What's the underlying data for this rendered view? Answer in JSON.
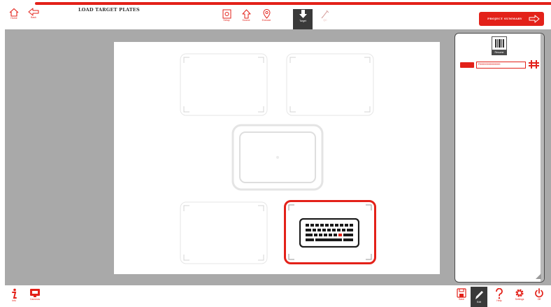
{
  "header": {
    "home_label": "Home",
    "back_label": "Back",
    "title": "LOAD TARGET PLATES",
    "steps": [
      {
        "label": "Setup",
        "icon": "setup-icon",
        "state": "normal"
      },
      {
        "label": "Source",
        "icon": "upload-arrow-icon",
        "state": "normal"
      },
      {
        "label": "Execute",
        "icon": "location-pin-icon",
        "state": "normal"
      },
      {
        "label": "Target",
        "icon": "download-arrow-icon",
        "state": "active"
      },
      {
        "label": "QC",
        "icon": "pipette-icon",
        "state": "disabled"
      }
    ],
    "project_summary_label": "PROJECT SUMMARY"
  },
  "right_panel": {
    "resume_label": "Resume",
    "barcode_value": "P00000000000000"
  },
  "footer": {
    "info_label": "Info",
    "camera_label": "Cameras",
    "right_buttons": [
      {
        "label": "Save",
        "icon": "save-icon",
        "state": "normal"
      },
      {
        "label": "Edit",
        "icon": "pencil-icon",
        "state": "active"
      },
      {
        "label": "Help",
        "icon": "help-icon",
        "state": "normal"
      },
      {
        "label": "Settings",
        "icon": "gear-icon",
        "state": "normal"
      },
      {
        "label": "Off",
        "icon": "power-icon",
        "state": "normal"
      }
    ]
  },
  "colors": {
    "accent": "#e32119",
    "dark": "#3a3a3a",
    "workspace_bg": "#a9a9a9"
  }
}
